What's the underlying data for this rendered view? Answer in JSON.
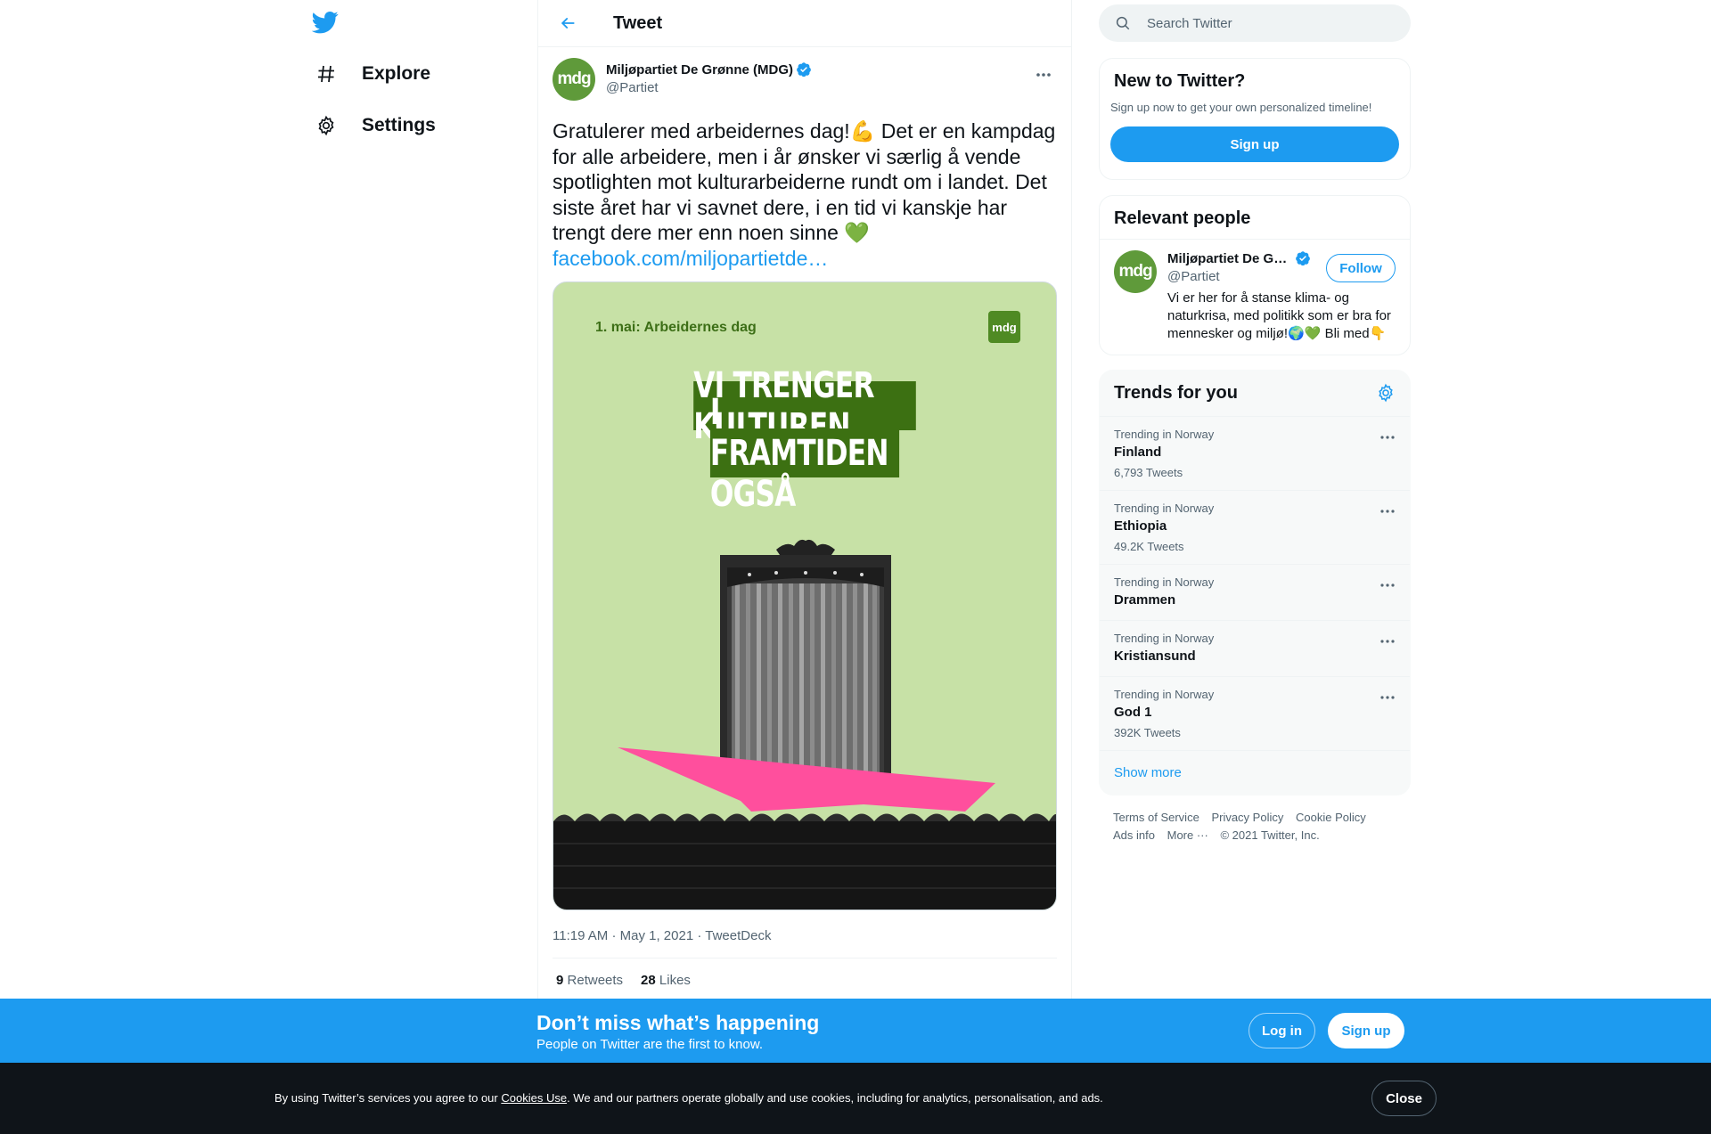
{
  "nav": {
    "items": [
      {
        "label": "Explore",
        "icon": "hashtag-icon"
      },
      {
        "label": "Settings",
        "icon": "gear-icon"
      }
    ]
  },
  "header": {
    "title": "Tweet"
  },
  "tweet": {
    "author_name": "Miljøpartiet De Grønne (MDG)",
    "author_handle": "@Partiet",
    "avatar_text": "mdg",
    "text": "Gratulerer med arbeidernes dag!💪 Det er en kampdag for alle arbeidere, men i år ønsker vi særlig å vende spotlighten mot kulturarbeiderne rundt om i landet. Det siste året har vi savnet dere, i en tid vi kanskje har trengt dere mer enn noen sinne 💚",
    "link": "facebook.com/miljopartietde…",
    "media": {
      "subtitle": "1. mai: Arbeidernes dag",
      "logo_text": "mdg",
      "headline_line1": "VI TRENGER KULTUREN",
      "headline_line2": "I FRAMTIDEN OGSÅ"
    },
    "time": "11:19 AM",
    "date": "May 1, 2021",
    "source": "TweetDeck",
    "separator": "·",
    "retweets_count": "9",
    "retweets_label": "Retweets",
    "likes_count": "28",
    "likes_label": "Likes"
  },
  "search": {
    "placeholder": "Search Twitter"
  },
  "new_to_twitter": {
    "title": "New to Twitter?",
    "subtitle": "Sign up now to get your own personalized timeline!",
    "button": "Sign up"
  },
  "relevant_people": {
    "title": "Relevant people",
    "name": "Miljøpartiet De Gr…",
    "handle": "@Partiet",
    "avatar_text": "mdg",
    "follow": "Follow",
    "bio": "Vi er her for å stanse klima- og naturkrisa, med politikk som er bra for mennesker og miljø!🌍💚 Bli med👇"
  },
  "trends": {
    "title": "Trends for you",
    "items": [
      {
        "context": "Trending in Norway",
        "name": "Finland",
        "count": "6,793 Tweets"
      },
      {
        "context": "Trending in Norway",
        "name": "Ethiopia",
        "count": "49.2K Tweets"
      },
      {
        "context": "Trending in Norway",
        "name": "Drammen",
        "count": ""
      },
      {
        "context": "Trending in Norway",
        "name": "Kristiansund",
        "count": ""
      },
      {
        "context": "Trending in Norway",
        "name": "God 1",
        "count": "392K Tweets"
      }
    ],
    "show_more": "Show more"
  },
  "footer": {
    "terms": "Terms of Service",
    "privacy": "Privacy Policy",
    "cookie": "Cookie Policy",
    "ads": "Ads info",
    "more": "More ···",
    "copyright": "© 2021 Twitter, Inc."
  },
  "banner": {
    "title": "Don’t miss what’s happening",
    "subtitle": "People on Twitter are the first to know.",
    "login": "Log in",
    "signup": "Sign up"
  },
  "cookie_bar": {
    "text_before": "By using Twitter’s services you agree to our ",
    "link": "Cookies Use",
    "text_after": ". We and our partners operate globally and use cookies, including for analytics, personalisation, and ads.",
    "close": "Close"
  },
  "colors": {
    "accent": "#1d9bf0",
    "mdg_green": "#5f9a3a",
    "poster_bg": "#c7e1a6",
    "poster_dark_green": "#3c7012",
    "poster_pink": "#ff4f9d"
  }
}
